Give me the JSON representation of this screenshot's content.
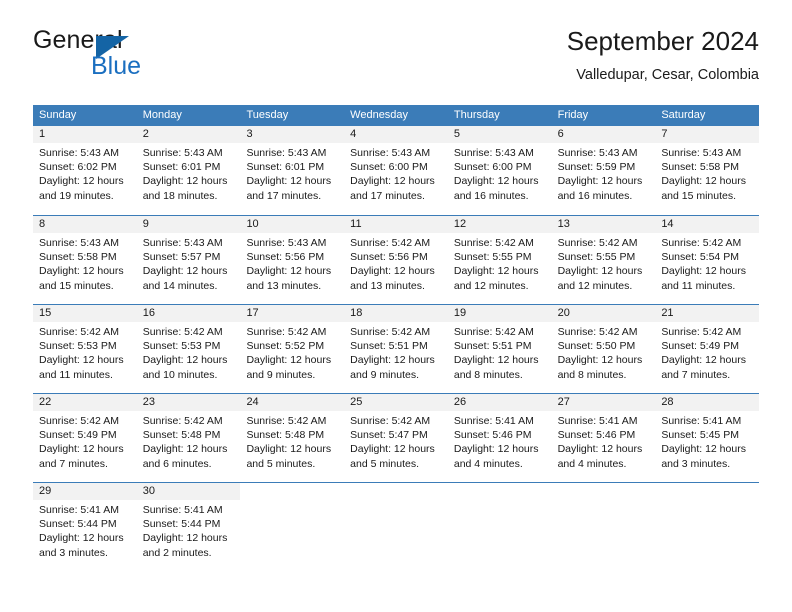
{
  "brand": {
    "name_part1": "General",
    "name_part2": "Blue",
    "logo_icon": "triangle-icon",
    "primary_color": "#1464a5",
    "accent_color": "#1b6fc0"
  },
  "header": {
    "title": "September 2024",
    "subtitle": "Valledupar, Cesar, Colombia"
  },
  "calendar": {
    "header_bg_color": "#3b7cb8",
    "daynum_band_color": "#f2f2f2",
    "weekdays": [
      "Sunday",
      "Monday",
      "Tuesday",
      "Wednesday",
      "Thursday",
      "Friday",
      "Saturday"
    ],
    "weeks": [
      [
        {
          "day": "1",
          "sunrise": "Sunrise: 5:43 AM",
          "sunset": "Sunset: 6:02 PM",
          "daylight_line1": "Daylight: 12 hours",
          "daylight_line2": "and 19 minutes."
        },
        {
          "day": "2",
          "sunrise": "Sunrise: 5:43 AM",
          "sunset": "Sunset: 6:01 PM",
          "daylight_line1": "Daylight: 12 hours",
          "daylight_line2": "and 18 minutes."
        },
        {
          "day": "3",
          "sunrise": "Sunrise: 5:43 AM",
          "sunset": "Sunset: 6:01 PM",
          "daylight_line1": "Daylight: 12 hours",
          "daylight_line2": "and 17 minutes."
        },
        {
          "day": "4",
          "sunrise": "Sunrise: 5:43 AM",
          "sunset": "Sunset: 6:00 PM",
          "daylight_line1": "Daylight: 12 hours",
          "daylight_line2": "and 17 minutes."
        },
        {
          "day": "5",
          "sunrise": "Sunrise: 5:43 AM",
          "sunset": "Sunset: 6:00 PM",
          "daylight_line1": "Daylight: 12 hours",
          "daylight_line2": "and 16 minutes."
        },
        {
          "day": "6",
          "sunrise": "Sunrise: 5:43 AM",
          "sunset": "Sunset: 5:59 PM",
          "daylight_line1": "Daylight: 12 hours",
          "daylight_line2": "and 16 minutes."
        },
        {
          "day": "7",
          "sunrise": "Sunrise: 5:43 AM",
          "sunset": "Sunset: 5:58 PM",
          "daylight_line1": "Daylight: 12 hours",
          "daylight_line2": "and 15 minutes."
        }
      ],
      [
        {
          "day": "8",
          "sunrise": "Sunrise: 5:43 AM",
          "sunset": "Sunset: 5:58 PM",
          "daylight_line1": "Daylight: 12 hours",
          "daylight_line2": "and 15 minutes."
        },
        {
          "day": "9",
          "sunrise": "Sunrise: 5:43 AM",
          "sunset": "Sunset: 5:57 PM",
          "daylight_line1": "Daylight: 12 hours",
          "daylight_line2": "and 14 minutes."
        },
        {
          "day": "10",
          "sunrise": "Sunrise: 5:43 AM",
          "sunset": "Sunset: 5:56 PM",
          "daylight_line1": "Daylight: 12 hours",
          "daylight_line2": "and 13 minutes."
        },
        {
          "day": "11",
          "sunrise": "Sunrise: 5:42 AM",
          "sunset": "Sunset: 5:56 PM",
          "daylight_line1": "Daylight: 12 hours",
          "daylight_line2": "and 13 minutes."
        },
        {
          "day": "12",
          "sunrise": "Sunrise: 5:42 AM",
          "sunset": "Sunset: 5:55 PM",
          "daylight_line1": "Daylight: 12 hours",
          "daylight_line2": "and 12 minutes."
        },
        {
          "day": "13",
          "sunrise": "Sunrise: 5:42 AM",
          "sunset": "Sunset: 5:55 PM",
          "daylight_line1": "Daylight: 12 hours",
          "daylight_line2": "and 12 minutes."
        },
        {
          "day": "14",
          "sunrise": "Sunrise: 5:42 AM",
          "sunset": "Sunset: 5:54 PM",
          "daylight_line1": "Daylight: 12 hours",
          "daylight_line2": "and 11 minutes."
        }
      ],
      [
        {
          "day": "15",
          "sunrise": "Sunrise: 5:42 AM",
          "sunset": "Sunset: 5:53 PM",
          "daylight_line1": "Daylight: 12 hours",
          "daylight_line2": "and 11 minutes."
        },
        {
          "day": "16",
          "sunrise": "Sunrise: 5:42 AM",
          "sunset": "Sunset: 5:53 PM",
          "daylight_line1": "Daylight: 12 hours",
          "daylight_line2": "and 10 minutes."
        },
        {
          "day": "17",
          "sunrise": "Sunrise: 5:42 AM",
          "sunset": "Sunset: 5:52 PM",
          "daylight_line1": "Daylight: 12 hours",
          "daylight_line2": "and 9 minutes."
        },
        {
          "day": "18",
          "sunrise": "Sunrise: 5:42 AM",
          "sunset": "Sunset: 5:51 PM",
          "daylight_line1": "Daylight: 12 hours",
          "daylight_line2": "and 9 minutes."
        },
        {
          "day": "19",
          "sunrise": "Sunrise: 5:42 AM",
          "sunset": "Sunset: 5:51 PM",
          "daylight_line1": "Daylight: 12 hours",
          "daylight_line2": "and 8 minutes."
        },
        {
          "day": "20",
          "sunrise": "Sunrise: 5:42 AM",
          "sunset": "Sunset: 5:50 PM",
          "daylight_line1": "Daylight: 12 hours",
          "daylight_line2": "and 8 minutes."
        },
        {
          "day": "21",
          "sunrise": "Sunrise: 5:42 AM",
          "sunset": "Sunset: 5:49 PM",
          "daylight_line1": "Daylight: 12 hours",
          "daylight_line2": "and 7 minutes."
        }
      ],
      [
        {
          "day": "22",
          "sunrise": "Sunrise: 5:42 AM",
          "sunset": "Sunset: 5:49 PM",
          "daylight_line1": "Daylight: 12 hours",
          "daylight_line2": "and 7 minutes."
        },
        {
          "day": "23",
          "sunrise": "Sunrise: 5:42 AM",
          "sunset": "Sunset: 5:48 PM",
          "daylight_line1": "Daylight: 12 hours",
          "daylight_line2": "and 6 minutes."
        },
        {
          "day": "24",
          "sunrise": "Sunrise: 5:42 AM",
          "sunset": "Sunset: 5:48 PM",
          "daylight_line1": "Daylight: 12 hours",
          "daylight_line2": "and 5 minutes."
        },
        {
          "day": "25",
          "sunrise": "Sunrise: 5:42 AM",
          "sunset": "Sunset: 5:47 PM",
          "daylight_line1": "Daylight: 12 hours",
          "daylight_line2": "and 5 minutes."
        },
        {
          "day": "26",
          "sunrise": "Sunrise: 5:41 AM",
          "sunset": "Sunset: 5:46 PM",
          "daylight_line1": "Daylight: 12 hours",
          "daylight_line2": "and 4 minutes."
        },
        {
          "day": "27",
          "sunrise": "Sunrise: 5:41 AM",
          "sunset": "Sunset: 5:46 PM",
          "daylight_line1": "Daylight: 12 hours",
          "daylight_line2": "and 4 minutes."
        },
        {
          "day": "28",
          "sunrise": "Sunrise: 5:41 AM",
          "sunset": "Sunset: 5:45 PM",
          "daylight_line1": "Daylight: 12 hours",
          "daylight_line2": "and 3 minutes."
        }
      ],
      [
        {
          "day": "29",
          "sunrise": "Sunrise: 5:41 AM",
          "sunset": "Sunset: 5:44 PM",
          "daylight_line1": "Daylight: 12 hours",
          "daylight_line2": "and 3 minutes."
        },
        {
          "day": "30",
          "sunrise": "Sunrise: 5:41 AM",
          "sunset": "Sunset: 5:44 PM",
          "daylight_line1": "Daylight: 12 hours",
          "daylight_line2": "and 2 minutes."
        },
        {
          "day": "",
          "sunrise": "",
          "sunset": "",
          "daylight_line1": "",
          "daylight_line2": ""
        },
        {
          "day": "",
          "sunrise": "",
          "sunset": "",
          "daylight_line1": "",
          "daylight_line2": ""
        },
        {
          "day": "",
          "sunrise": "",
          "sunset": "",
          "daylight_line1": "",
          "daylight_line2": ""
        },
        {
          "day": "",
          "sunrise": "",
          "sunset": "",
          "daylight_line1": "",
          "daylight_line2": ""
        },
        {
          "day": "",
          "sunrise": "",
          "sunset": "",
          "daylight_line1": "",
          "daylight_line2": ""
        }
      ]
    ]
  }
}
